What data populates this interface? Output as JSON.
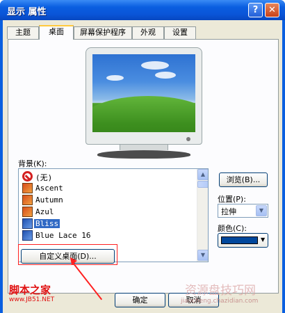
{
  "window": {
    "title": "显示 属性",
    "help_glyph": "?",
    "close_glyph": "✕"
  },
  "tabs": [
    {
      "label": "主题",
      "active": false
    },
    {
      "label": "桌面",
      "active": true
    },
    {
      "label": "屏幕保护程序",
      "active": false
    },
    {
      "label": "外观",
      "active": false
    },
    {
      "label": "设置",
      "active": false
    }
  ],
  "background": {
    "label": "背景(K):",
    "items": [
      {
        "label": "(无)",
        "icon": "none-icon",
        "selected": false
      },
      {
        "label": "Ascent",
        "icon": "image-file-icon",
        "selected": false
      },
      {
        "label": "Autumn",
        "icon": "image-file-icon",
        "selected": false
      },
      {
        "label": "Azul",
        "icon": "image-file-icon",
        "selected": false
      },
      {
        "label": "Bliss",
        "icon": "image-file-icon",
        "selected": true
      },
      {
        "label": "Blue Lace 16",
        "icon": "image-file-icon",
        "selected": false
      }
    ],
    "browse_label": "浏览(B)...",
    "customize_label": "自定义桌面(D)..."
  },
  "position": {
    "label": "位置(P):",
    "value": "拉伸"
  },
  "color": {
    "label": "颜色(C):",
    "value": "#00479c"
  },
  "buttons": {
    "ok": "确定",
    "cancel": "取消"
  },
  "watermarks": {
    "left_title": "脚本之家",
    "left_url": "www.JB51.NET",
    "right_title": "资源盘技巧网",
    "right_url": "jiaocheng.chazidian.com"
  }
}
